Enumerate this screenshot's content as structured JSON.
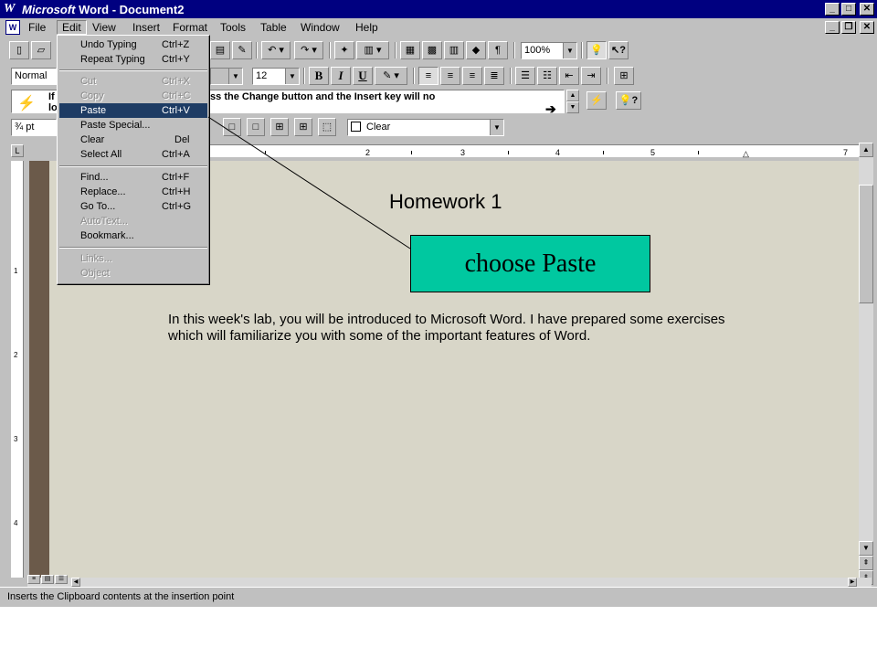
{
  "window": {
    "logo_letter": "W",
    "title_brand": "Microsoft",
    "title_rest": " Word - Document2",
    "btn_minimize": "_",
    "btn_maximize": "□",
    "btn_close": "✕"
  },
  "menubar": {
    "items": [
      "File",
      "Edit",
      "View",
      "Insert",
      "Format",
      "Tools",
      "Table",
      "Window",
      "Help"
    ],
    "active": "Edit"
  },
  "standard_toolbar": {
    "zoom": "100%"
  },
  "format_toolbar": {
    "style": "Normal",
    "font_size": "12",
    "bold": "B",
    "italic": "I",
    "underline": "U"
  },
  "tipbar": {
    "line1": "If                                       Word, press the Change button and the Insert key will no",
    "line2": "lo                                       ode."
  },
  "borders_toolbar": {
    "line_width": "¾ pt",
    "shading": "Clear"
  },
  "ruler": {
    "numbers": [
      "1",
      "2",
      "3",
      "4",
      "5",
      "7"
    ],
    "vertical_numbers": [
      "1",
      "2",
      "3",
      "4"
    ]
  },
  "edit_menu": {
    "items": [
      {
        "label": "Undo Typing",
        "shortcut": "Ctrl+Z",
        "state": "enabled"
      },
      {
        "label": "Repeat Typing",
        "shortcut": "Ctrl+Y",
        "state": "enabled"
      },
      {
        "label": "Cut",
        "shortcut": "Ctrl+X",
        "state": "disabled"
      },
      {
        "label": "Copy",
        "shortcut": "Ctrl+C",
        "state": "disabled"
      },
      {
        "label": "Paste",
        "shortcut": "Ctrl+V",
        "state": "highlighted"
      },
      {
        "label": "Paste Special...",
        "shortcut": "",
        "state": "enabled"
      },
      {
        "label": "Clear",
        "shortcut": "Del",
        "state": "enabled"
      },
      {
        "label": "Select All",
        "shortcut": "Ctrl+A",
        "state": "enabled"
      },
      {
        "label": "Find...",
        "shortcut": "Ctrl+F",
        "state": "enabled"
      },
      {
        "label": "Replace...",
        "shortcut": "Ctrl+H",
        "state": "enabled"
      },
      {
        "label": "Go To...",
        "shortcut": "Ctrl+G",
        "state": "enabled"
      },
      {
        "label": "AutoText...",
        "shortcut": "",
        "state": "disabled"
      },
      {
        "label": "Bookmark...",
        "shortcut": "",
        "state": "enabled"
      },
      {
        "label": "Links...",
        "shortcut": "",
        "state": "disabled"
      },
      {
        "label": "Object",
        "shortcut": "",
        "state": "disabled"
      }
    ]
  },
  "document": {
    "heading": "Homework 1",
    "paragraph": "In this week's lab, you will be introduced to Microsoft Word. I have prepared some exercises which will familiarize you with some of the important features of Word."
  },
  "callout": {
    "text": "choose Paste"
  },
  "statusbar": {
    "message": "Inserts the Clipboard contents at the insertion point"
  },
  "colors": {
    "titlebar": "#000080",
    "menu_highlight": "#1e3c64",
    "callout_fill": "#00c8a0",
    "page": "#d8d6c8"
  }
}
